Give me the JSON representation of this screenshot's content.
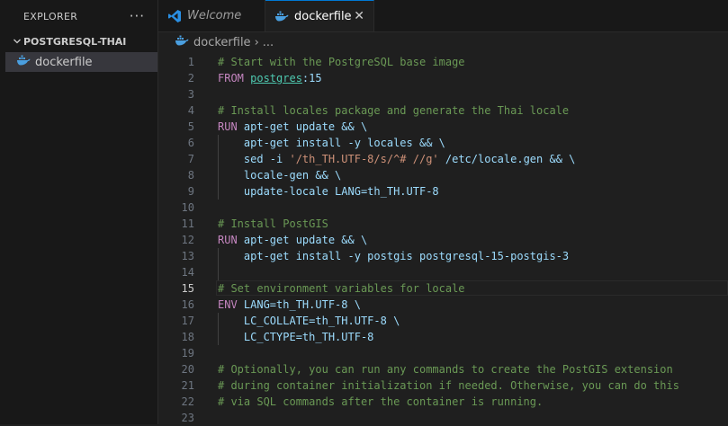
{
  "sidebar": {
    "title": "EXPLORER",
    "more_actions": "···",
    "folder": "POSTGRESQL-THAI",
    "file": "dockerfile"
  },
  "tabs": [
    {
      "label": "Welcome",
      "icon": "vscode-icon",
      "active": false
    },
    {
      "label": "dockerfile",
      "icon": "docker-whale-icon",
      "active": true,
      "close": "✕"
    }
  ],
  "breadcrumb": {
    "file": "dockerfile",
    "separator": "›",
    "more": "..."
  },
  "editor": {
    "current_line": 15,
    "lines": [
      {
        "n": "1",
        "tokens": [
          {
            "c": "comment",
            "t": "# Start with the PostgreSQL base image"
          }
        ]
      },
      {
        "n": "2",
        "tokens": [
          {
            "c": "keyword",
            "t": "FROM "
          },
          {
            "c": "image",
            "t": "postgres"
          },
          {
            "c": "text",
            "t": ":15"
          }
        ]
      },
      {
        "n": "3",
        "tokens": []
      },
      {
        "n": "4",
        "tokens": [
          {
            "c": "comment",
            "t": "# Install locales package and generate the Thai locale"
          }
        ]
      },
      {
        "n": "5",
        "tokens": [
          {
            "c": "keyword",
            "t": "RUN "
          },
          {
            "c": "text",
            "t": "apt-get update && \\"
          }
        ]
      },
      {
        "n": "6",
        "tokens": [
          {
            "c": "text",
            "t": "    apt-get install -y locales && \\"
          }
        ]
      },
      {
        "n": "7",
        "tokens": [
          {
            "c": "text",
            "t": "    sed -i "
          },
          {
            "c": "string",
            "t": "'/th_TH.UTF-8/s/^# //g'"
          },
          {
            "c": "text",
            "t": " /etc/locale.gen && \\"
          }
        ]
      },
      {
        "n": "8",
        "tokens": [
          {
            "c": "text",
            "t": "    locale-gen && \\"
          }
        ]
      },
      {
        "n": "9",
        "tokens": [
          {
            "c": "text",
            "t": "    update-locale LANG=th_TH.UTF-8"
          }
        ]
      },
      {
        "n": "10",
        "tokens": []
      },
      {
        "n": "11",
        "tokens": [
          {
            "c": "comment",
            "t": "# Install PostGIS"
          }
        ]
      },
      {
        "n": "12",
        "tokens": [
          {
            "c": "keyword",
            "t": "RUN "
          },
          {
            "c": "text",
            "t": "apt-get update && \\"
          }
        ]
      },
      {
        "n": "13",
        "tokens": [
          {
            "c": "text",
            "t": "    apt-get install -y postgis postgresql-15-postgis-3"
          }
        ]
      },
      {
        "n": "14",
        "tokens": []
      },
      {
        "n": "15",
        "tokens": [
          {
            "c": "comment",
            "t": "# Set environment variables for locale"
          }
        ]
      },
      {
        "n": "16",
        "tokens": [
          {
            "c": "keyword",
            "t": "ENV "
          },
          {
            "c": "text",
            "t": "LANG=th_TH.UTF-8 \\"
          }
        ]
      },
      {
        "n": "17",
        "tokens": [
          {
            "c": "text",
            "t": "    LC_COLLATE=th_TH.UTF-8 \\"
          }
        ]
      },
      {
        "n": "18",
        "tokens": [
          {
            "c": "text",
            "t": "    LC_CTYPE=th_TH.UTF-8"
          }
        ]
      },
      {
        "n": "19",
        "tokens": []
      },
      {
        "n": "20",
        "tokens": [
          {
            "c": "comment",
            "t": "# Optionally, you can run any commands to create the PostGIS extension"
          }
        ]
      },
      {
        "n": "21",
        "tokens": [
          {
            "c": "comment",
            "t": "# during container initialization if needed. Otherwise, you can do this"
          }
        ]
      },
      {
        "n": "22",
        "tokens": [
          {
            "c": "comment",
            "t": "# via SQL commands after the container is running."
          }
        ]
      },
      {
        "n": "23",
        "tokens": []
      }
    ]
  },
  "colors": {
    "background": "#1f1f1f",
    "sidebar": "#181818",
    "comment": "#6a9955",
    "keyword": "#c586c0",
    "accent": "#0078d4",
    "docker_blue": "#4a9fe0"
  }
}
